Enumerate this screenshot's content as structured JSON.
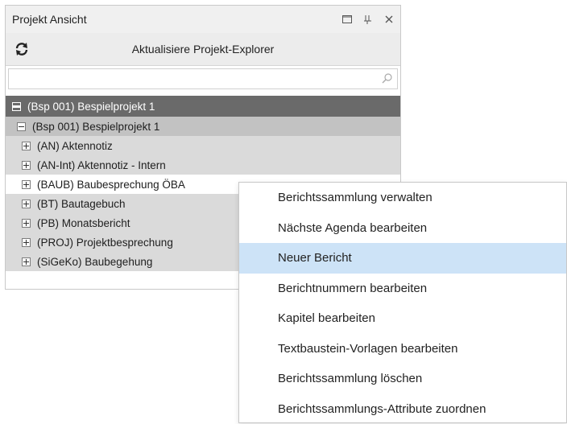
{
  "panel": {
    "title": "Projekt Ansicht",
    "refresh_label": "Aktualisiere Projekt-Explorer",
    "search": {
      "value": "",
      "placeholder": ""
    },
    "tree": {
      "root": "(Bsp 001) Bespielprojekt 1",
      "project": "(Bsp 001) Bespielprojekt 1",
      "items": [
        "(AN) Aktennotiz",
        "(AN-Int) Aktennotiz - Intern",
        "(BAUB) Baubesprechung ÖBA",
        "(BT) Bautagebuch",
        "(PB) Monatsbericht",
        "(PROJ) Projektbesprechung",
        "(SiGeKo) Baubegehung"
      ],
      "highlighted_index": 2
    }
  },
  "context_menu": {
    "items": [
      "Berichtssammlung verwalten",
      "Nächste Agenda bearbeiten",
      "Neuer Bericht",
      "Berichtnummern bearbeiten",
      "Kapitel bearbeiten",
      "Textbaustein-Vorlagen bearbeiten",
      "Berichtssammlung löschen",
      "Berichtssammlungs-Attribute zuordnen"
    ],
    "active_index": 2
  },
  "icons": [
    "maximize-icon",
    "pin-icon",
    "close-icon",
    "refresh-icon",
    "search-icon",
    "collapse-icon",
    "expand-icon"
  ],
  "colors": {
    "menu_highlight": "#cde3f7",
    "root_row": "#6a6a6a",
    "project_row": "#c2c2c2",
    "item_row": "#dadada"
  }
}
